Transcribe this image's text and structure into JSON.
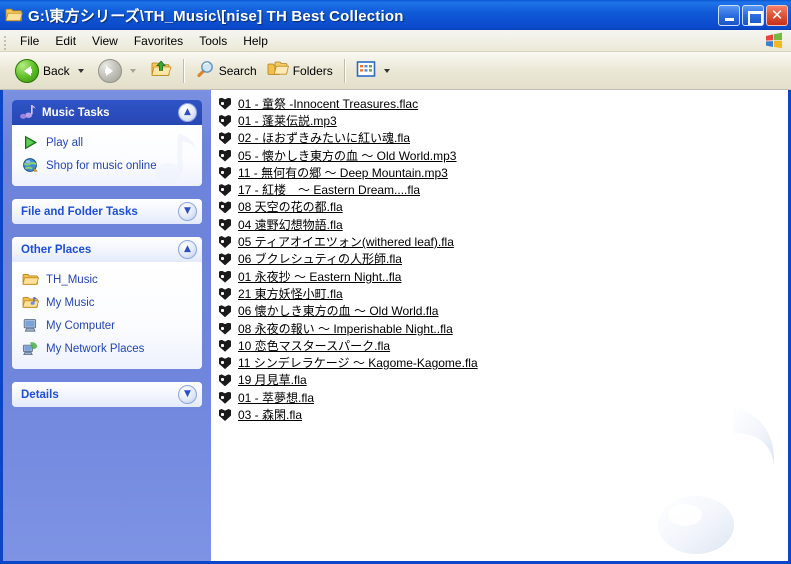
{
  "window": {
    "title": "G:\\東方シリーズ\\TH_Music\\[nise] TH Best Collection",
    "title_icon": "folder-icon",
    "minimize_label": "_",
    "maximize_label": "□",
    "close_label": "✕"
  },
  "menubar": {
    "items": [
      {
        "label": "File"
      },
      {
        "label": "Edit"
      },
      {
        "label": "View"
      },
      {
        "label": "Favorites"
      },
      {
        "label": "Tools"
      },
      {
        "label": "Help"
      }
    ],
    "logo": "windows-flag-logo"
  },
  "toolbar": {
    "back_label": "Back",
    "back_icon": "back-arrow-icon",
    "forward_icon": "forward-arrow-icon",
    "up_icon": "up-folder-icon",
    "search_label": "Search",
    "search_icon": "magnifier-icon",
    "folders_label": "Folders",
    "folders_icon": "folders-icon",
    "views_icon": "views-icon"
  },
  "sidebar": {
    "panels": [
      {
        "id": "music-tasks",
        "title": "Music Tasks",
        "header_icon": "music-note-icon",
        "chevron": "▲",
        "expanded": true,
        "tasks": [
          {
            "label": "Play all",
            "icon": "play-icon"
          },
          {
            "label": "Shop for music online",
            "icon": "globe-icon"
          }
        ]
      },
      {
        "id": "file-and-folder-tasks",
        "title": "File and Folder Tasks",
        "chevron": "▼",
        "expanded": false,
        "tasks": []
      },
      {
        "id": "other-places",
        "title": "Other Places",
        "chevron": "▲",
        "expanded": true,
        "tasks": [
          {
            "label": "TH_Music",
            "icon": "folder-icon"
          },
          {
            "label": "My Music",
            "icon": "my-music-folder-icon"
          },
          {
            "label": "My Computer",
            "icon": "my-computer-icon"
          },
          {
            "label": "My Network Places",
            "icon": "network-places-icon"
          }
        ]
      },
      {
        "id": "details",
        "title": "Details",
        "chevron": "▼",
        "expanded": false,
        "tasks": []
      }
    ]
  },
  "filelist": {
    "watermark_icon": "music-note-watermark",
    "files": [
      {
        "name": "01 - 童祭 -Innocent Treasures.flac",
        "icon": "foobar-orange-icon",
        "type": "orange"
      },
      {
        "name": "01 - 蓬莱伝説.mp3",
        "icon": "foobar-red-icon",
        "type": "red"
      },
      {
        "name": "02 - ほおずきみたいに紅い魂.fla",
        "icon": "foobar-orange-icon",
        "type": "orange"
      },
      {
        "name": "05 - 懐かしき東方の血 〜 Old World.mp3",
        "icon": "foobar-red-icon",
        "type": "red"
      },
      {
        "name": "11 - 無何有の郷 〜 Deep Mountain.mp3",
        "icon": "foobar-red-icon",
        "type": "red"
      },
      {
        "name": "17 - 紅楼　〜 Eastern Dream....fla",
        "icon": "foobar-orange-icon",
        "type": "orange"
      },
      {
        "name": "08 天空の花の都.fla",
        "icon": "foobar-orange-icon",
        "type": "orange"
      },
      {
        "name": "04 遠野幻想物語.fla",
        "icon": "foobar-orange-icon",
        "type": "orange"
      },
      {
        "name": "05 ティアオイエツォン(withered leaf).fla",
        "icon": "foobar-orange-icon",
        "type": "orange"
      },
      {
        "name": "06 ブクレシュティの人形師.fla",
        "icon": "foobar-orange-icon",
        "type": "orange"
      },
      {
        "name": "01 永夜抄 〜 Eastern Night..fla",
        "icon": "foobar-orange-icon",
        "type": "orange"
      },
      {
        "name": "21 東方妖怪小町.fla",
        "icon": "foobar-orange-icon",
        "type": "orange"
      },
      {
        "name": "06 懐かしき東方の血 〜 Old World.fla",
        "icon": "foobar-orange-icon",
        "type": "orange"
      },
      {
        "name": "08 永夜の報い 〜 Imperishable Night..fla",
        "icon": "foobar-orange-icon",
        "type": "orange"
      },
      {
        "name": "10 恋色マスタースパーク.fla",
        "icon": "foobar-orange-icon",
        "type": "orange"
      },
      {
        "name": "11 シンデレラケージ 〜 Kagome-Kagome.fla",
        "icon": "foobar-orange-icon",
        "type": "orange"
      },
      {
        "name": "19 月見草.fla",
        "icon": "foobar-orange-icon",
        "type": "orange"
      },
      {
        "name": "01 - 萃夢想.fla",
        "icon": "foobar-orange-icon",
        "type": "orange"
      },
      {
        "name": "03 - 森閑.fla",
        "icon": "foobar-orange-icon",
        "type": "orange"
      }
    ]
  },
  "colors": {
    "titlebar_blue": "#0b49cb",
    "window_border": "#0b46c8",
    "sidebar_bg": "#6f86dc",
    "panel_header_blue": "#2b4dbd",
    "link_blue": "#2245b8",
    "icon_orange": "#f79400",
    "icon_red": "#d62a18"
  }
}
